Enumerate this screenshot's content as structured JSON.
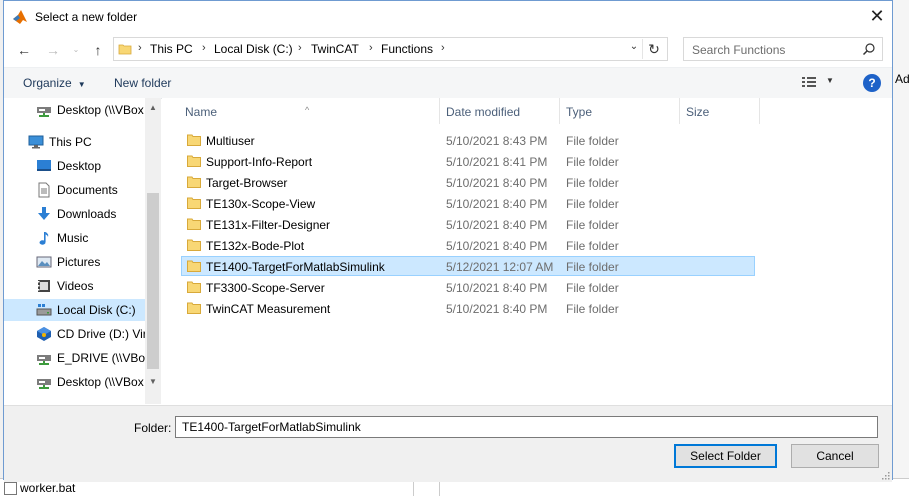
{
  "dialog": {
    "title": "Select a new folder",
    "close_glyph": "✕"
  },
  "background": {
    "right_fragment": "Ad",
    "bottom_file": "worker.bat"
  },
  "nav": {
    "back_glyph": "←",
    "forward_glyph": "→",
    "up_glyph": "↑"
  },
  "address": {
    "crumbs": [
      "This PC",
      "Local Disk (C:)",
      "TwinCAT",
      "Functions"
    ],
    "separator": "›",
    "dropdown_glyph": "⌄",
    "refresh_glyph": "↻"
  },
  "search": {
    "placeholder": "Search Functions"
  },
  "toolbar": {
    "organize": "Organize",
    "new_folder": "New folder",
    "help": "?",
    "caret": "▼"
  },
  "sidebar": {
    "items": [
      {
        "label": "Desktop (\\\\VBox",
        "icon": "network-drive-icon"
      },
      {
        "label": "This PC",
        "icon": "computer-icon"
      },
      {
        "label": "Desktop",
        "icon": "desktop-icon"
      },
      {
        "label": "Documents",
        "icon": "documents-icon"
      },
      {
        "label": "Downloads",
        "icon": "downloads-icon"
      },
      {
        "label": "Music",
        "icon": "music-icon"
      },
      {
        "label": "Pictures",
        "icon": "pictures-icon"
      },
      {
        "label": "Videos",
        "icon": "videos-icon"
      },
      {
        "label": "Local Disk (C:)",
        "icon": "drive-icon"
      },
      {
        "label": "CD Drive (D:) Vir",
        "icon": "cd-drive-icon"
      },
      {
        "label": "E_DRIVE (\\\\VBox",
        "icon": "network-drive-icon"
      },
      {
        "label": "Desktop (\\\\VBox",
        "icon": "network-drive-icon"
      }
    ],
    "selected_index": 8,
    "scroll_up": "▲",
    "scroll_down": "▼"
  },
  "files": {
    "columns": [
      "Name",
      "Date modified",
      "Type",
      "Size"
    ],
    "sort_glyph": "^",
    "rows": [
      {
        "name": "Multiuser",
        "date": "5/10/2021 8:43 PM",
        "type": "File folder"
      },
      {
        "name": "Support-Info-Report",
        "date": "5/10/2021 8:41 PM",
        "type": "File folder"
      },
      {
        "name": "Target-Browser",
        "date": "5/10/2021 8:40 PM",
        "type": "File folder"
      },
      {
        "name": "TE130x-Scope-View",
        "date": "5/10/2021 8:40 PM",
        "type": "File folder"
      },
      {
        "name": "TE131x-Filter-Designer",
        "date": "5/10/2021 8:40 PM",
        "type": "File folder"
      },
      {
        "name": "TE132x-Bode-Plot",
        "date": "5/10/2021 8:40 PM",
        "type": "File folder"
      },
      {
        "name": "TE1400-TargetForMatlabSimulink",
        "date": "5/12/2021 12:07 AM",
        "type": "File folder"
      },
      {
        "name": "TF3300-Scope-Server",
        "date": "5/10/2021 8:40 PM",
        "type": "File folder"
      },
      {
        "name": "TwinCAT Measurement",
        "date": "5/10/2021 8:40 PM",
        "type": "File folder"
      }
    ],
    "selected_index": 6
  },
  "footer": {
    "folder_label": "Folder:",
    "folder_value": "TE1400-TargetForMatlabSimulink",
    "select_button": "Select Folder",
    "cancel_button": "Cancel"
  },
  "colors": {
    "accent": "#0078d7",
    "selection": "#cce8ff",
    "folder": "#f8d775"
  }
}
